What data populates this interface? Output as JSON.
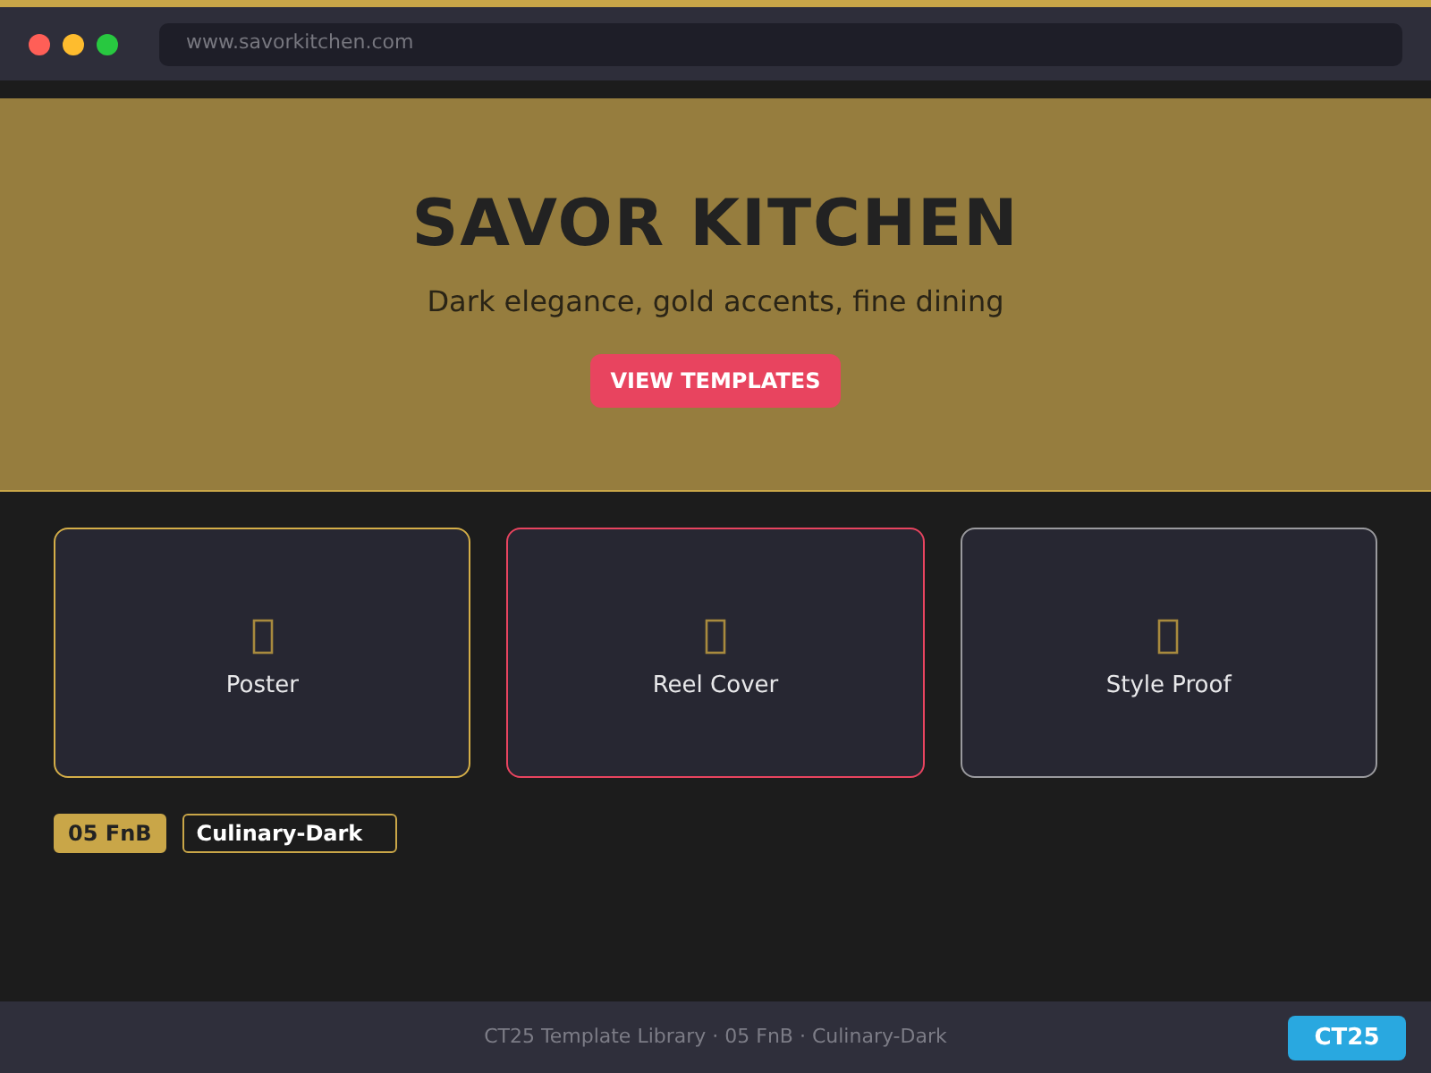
{
  "browser": {
    "url": "www.savorkitchen.com"
  },
  "hero": {
    "title": "SAVOR KITCHEN",
    "subtitle": "Dark elegance, gold accents, fine dining",
    "button": "VIEW TEMPLATES"
  },
  "cards": [
    {
      "label": "Poster",
      "color": "#d4ae48"
    },
    {
      "label": "Reel Cover",
      "color": "#e8445f"
    },
    {
      "label": "Style Proof",
      "color": "#9a9a9e"
    }
  ],
  "tags": [
    {
      "label": "05 FnB",
      "kind": "filled"
    },
    {
      "label": "Culinary-Dark",
      "kind": "outline"
    }
  ],
  "footer": {
    "text": "CT25 Template Library · 05 FnB · Culinary-Dark",
    "badge": "CT25"
  }
}
